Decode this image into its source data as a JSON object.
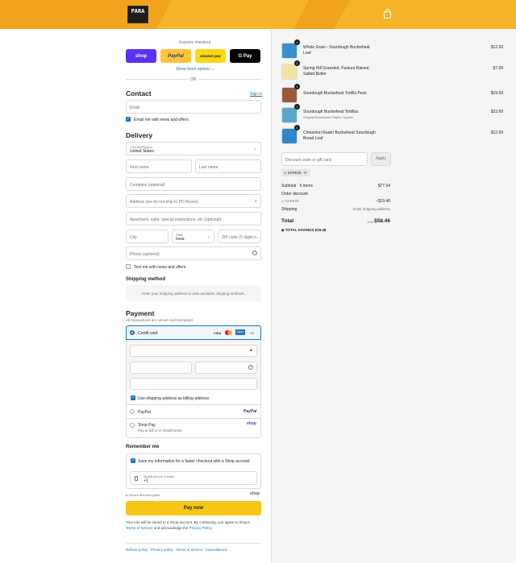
{
  "header": {
    "logo_text": "PARA",
    "cart_icon": "cart-icon"
  },
  "express": {
    "title": "Express checkout",
    "shop": "shop",
    "paypal": "PayPal",
    "amazon": "amazon pay",
    "gpay": "G Pay",
    "more": "Show more options ⌄",
    "or": "OR"
  },
  "contact": {
    "title": "Contact",
    "sign_in": "Sign in",
    "email_placeholder": "Email",
    "news": "Email me with news and offers"
  },
  "delivery": {
    "title": "Delivery",
    "country_label": "Country/Region",
    "country": "United States",
    "first": "First name",
    "last": "Last name",
    "company": "Company (optional)",
    "address": "Address (we do not ship to PO Boxes)",
    "apt": "Apartment, suite, special instructions, etc (optional)",
    "city": "City",
    "state_label": "State",
    "state": "Iowa",
    "zip": "ZIP code (5 digits o...",
    "phone": "Phone (optional)",
    "text_me": "Text me with news and offers"
  },
  "shipping": {
    "title": "Shipping method",
    "msg": "Enter your shipping address to view available shipping methods."
  },
  "payment": {
    "title": "Payment",
    "sub": "All transactions are secure and encrypted.",
    "credit": "Credit card",
    "cards": [
      "VISA",
      "MC",
      "AMEX",
      "+5"
    ],
    "billing": "Use shipping address as billing address",
    "paypal": "PayPal",
    "paypal_logo": "PayPal",
    "shoppay": "Shop Pay",
    "shoppay_sub": "Pay in full or in installments",
    "shoppay_logo": "shop"
  },
  "remember": {
    "title": "Remember me",
    "save": "Save my information for a faster checkout with a Shop account",
    "phone_label": "Mobile phone number",
    "phone_value": "+1",
    "secure": "Secure and encrypted",
    "shop": "shop"
  },
  "pay_button": "Pay now",
  "legal": {
    "text1": "Your info will be saved to a Shop account. By continuing, you agree to Shop's",
    "tos": "Terms of Service",
    "and": " and acknowledge the ",
    "privacy": "Privacy Policy",
    "dot": "."
  },
  "footer_links": [
    "Refund policy",
    "Privacy policy",
    "Terms of service",
    "Cancellations"
  ],
  "items": [
    {
      "qty": "1",
      "name": "Whole Grain - Sourdough Buckwheat Loaf",
      "variant": "",
      "price": "$12.99",
      "color": "#3a8fcf"
    },
    {
      "qty": "1",
      "name": "Spring Hill Grassfed, Pasture Raised, Salted Butter",
      "variant": "",
      "price": "$7.99",
      "color": "#f3e3a0"
    },
    {
      "qty": "1",
      "name": "Sourdough Buckwheat Tortilla Pack",
      "variant": "",
      "price": "$19.99",
      "color": "#9b5a3c"
    },
    {
      "qty": "1",
      "name": "Sourdough Buckwheat Tortillas",
      "variant": "Original Buckwheat Flajita / 3-pack",
      "price": "$23.99",
      "color": "#5aa8c9"
    },
    {
      "qty": "1",
      "name": "Cinnamon Raisin Buckwheat Sourdough Bread Loaf",
      "variant": "",
      "price": "$12.99",
      "color": "#2f86c8"
    }
  ],
  "discount": {
    "placeholder": "Discount code or gift card",
    "apply": "Apply",
    "code": "SAFE25"
  },
  "summary": {
    "subtotal_label": "Subtotal · 5 items",
    "subtotal": "$77.94",
    "order_discount": "Order discount",
    "code": "SAFE25",
    "discount": "−$19.48",
    "shipping_label": "Shipping",
    "shipping": "Enter shipping address",
    "total_label": "Total",
    "currency": "USD",
    "total": "$58.46",
    "savings_label": "TOTAL SAVINGS",
    "savings": "$19.48"
  }
}
